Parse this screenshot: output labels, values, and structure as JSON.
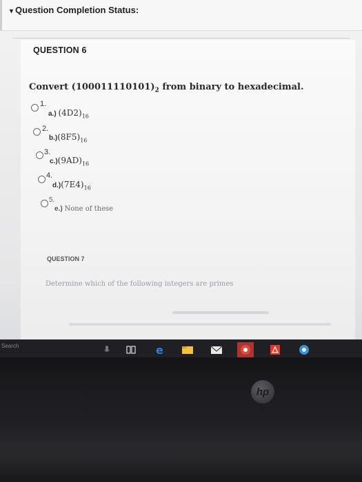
{
  "status": {
    "title": "Question Completion Status:"
  },
  "question6": {
    "heading": "QUESTION 6",
    "prompt_prefix": "Convert (100011110101)",
    "prompt_sub": "2",
    "prompt_suffix": " from binary to hexadecimal.",
    "options": [
      {
        "num": "1.",
        "label": "a.)",
        "value": "(4D2)",
        "sub": "16"
      },
      {
        "num": "2.",
        "label": "b.)",
        "value": "(8F5)",
        "sub": "16"
      },
      {
        "num": "3.",
        "label": "c.)",
        "value": "(9AD)",
        "sub": "16"
      },
      {
        "num": "4.",
        "label": "d.)",
        "value": "(7E4)",
        "sub": "16"
      },
      {
        "num": "5.",
        "label": "e.)",
        "value": "None of these",
        "sub": ""
      }
    ]
  },
  "question7": {
    "heading": "QUESTION 7",
    "prompt": "Determine which of the following integers are primes"
  },
  "taskbar": {
    "search": "Search",
    "icons": [
      "mic-icon",
      "task-view-icon",
      "edge-icon",
      "file-explorer-icon",
      "mail-icon",
      "chrome-icon",
      "pdf-icon",
      "app-icon"
    ]
  },
  "device": {
    "logo": "hp"
  },
  "colors": {
    "edge": "#2c7fd6",
    "explorer": "#f2c044",
    "chrome": "#e04b3b",
    "pdf": "#e03a2e",
    "app": "#3b8ed8"
  }
}
